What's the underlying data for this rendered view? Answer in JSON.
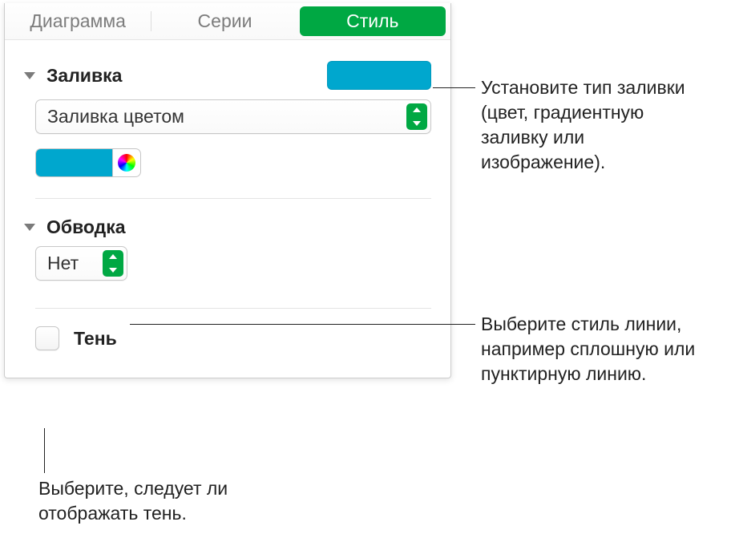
{
  "tabs": {
    "chart": "Диаграмма",
    "series": "Серии",
    "style": "Стиль"
  },
  "fill": {
    "title": "Заливка",
    "mode": "Заливка цветом"
  },
  "stroke": {
    "title": "Обводка",
    "mode": "Нет"
  },
  "shadow": {
    "title": "Тень"
  },
  "callouts": {
    "fill": "Установите тип заливки (цвет, градиентную заливку или изображение).",
    "stroke": "Выберите стиль линии, например сплошную или пунктирную линию.",
    "shadow": "Выберите, следует ли отображать тень."
  },
  "colors": {
    "accent": "#00a7ce",
    "green": "#00a843"
  }
}
